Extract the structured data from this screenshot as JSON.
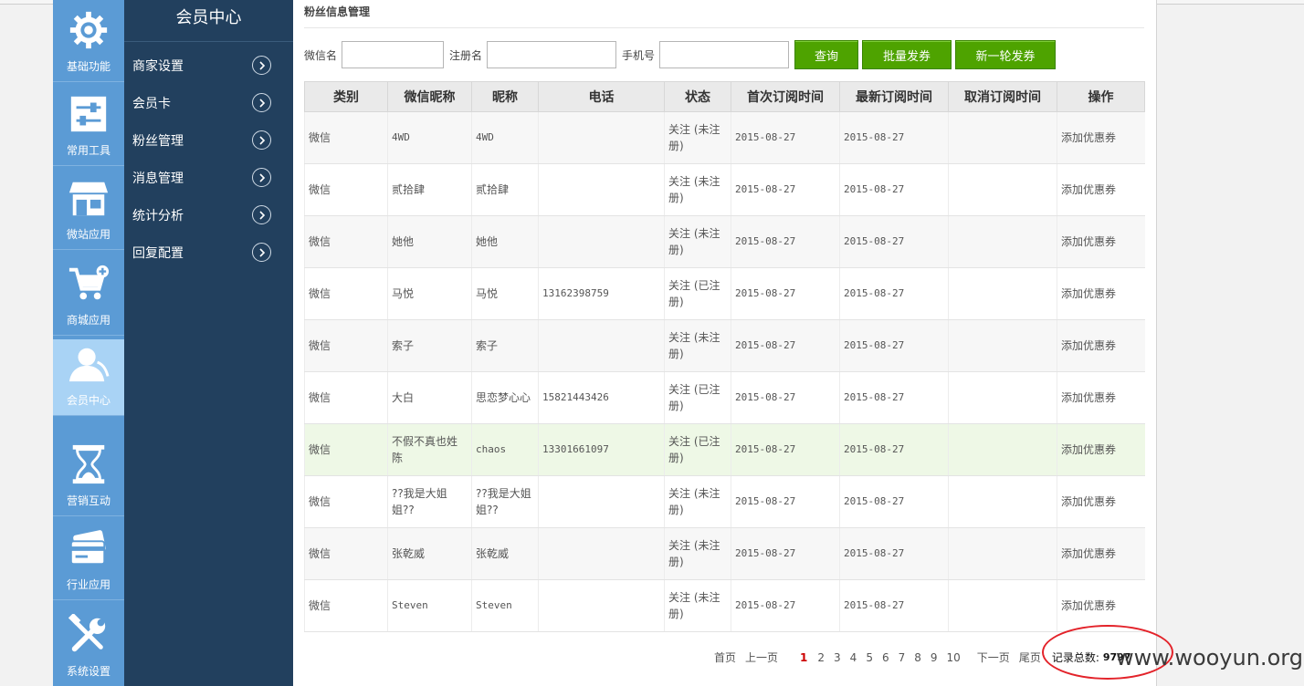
{
  "nav": [
    {
      "label": "基础功能",
      "icon": "gear-icon"
    },
    {
      "label": "常用工具",
      "icon": "toggle-tools-icon"
    },
    {
      "label": "微站应用",
      "icon": "storefront-icon"
    },
    {
      "label": "商城应用",
      "icon": "cart-add-icon"
    },
    {
      "label": "会员中心",
      "icon": "member-user-icon"
    },
    {
      "label": "营销互动",
      "icon": "hourglass-icon"
    },
    {
      "label": "行业应用",
      "icon": "cards-icon"
    },
    {
      "label": "系统设置",
      "icon": "tools-wrench-icon"
    }
  ],
  "submenu": {
    "title": "会员中心",
    "items": [
      "商家设置",
      "会员卡",
      "粉丝管理",
      "消息管理",
      "统计分析",
      "回复配置"
    ]
  },
  "page": {
    "title": "粉丝信息管理"
  },
  "search": {
    "wechat_label": "微信名",
    "reg_label": "注册名",
    "phone_label": "手机号",
    "query_btn": "查询",
    "batch_btn": "批量发券",
    "new_round_btn": "新一轮发券"
  },
  "table": {
    "headers": [
      "类别",
      "微信昵称",
      "昵称",
      "电话",
      "状态",
      "首次订阅时间",
      "最新订阅时间",
      "取消订阅时间",
      "操作"
    ],
    "rows": [
      [
        "微信",
        "4WD",
        "4WD",
        "",
        "关注 (未注册)",
        "2015-08-27",
        "2015-08-27",
        "",
        "添加优惠券"
      ],
      [
        "微信",
        "贰拾肆",
        "贰拾肆",
        "",
        "关注 (未注册)",
        "2015-08-27",
        "2015-08-27",
        "",
        "添加优惠券"
      ],
      [
        "微信",
        "她他",
        "她他",
        "",
        "关注 (未注册)",
        "2015-08-27",
        "2015-08-27",
        "",
        "添加优惠券"
      ],
      [
        "微信",
        "马悦",
        "马悦",
        "13162398759",
        "关注 (已注册)",
        "2015-08-27",
        "2015-08-27",
        "",
        "添加优惠券"
      ],
      [
        "微信",
        "索子",
        "索子",
        "",
        "关注 (未注册)",
        "2015-08-27",
        "2015-08-27",
        "",
        "添加优惠券"
      ],
      [
        "微信",
        "大白",
        "思恋梦心心",
        "15821443426",
        "关注 (已注册)",
        "2015-08-27",
        "2015-08-27",
        "",
        "添加优惠券"
      ],
      [
        "微信",
        "不假不真也姓陈",
        "chaos",
        "13301661097",
        "关注 (已注册)",
        "2015-08-27",
        "2015-08-27",
        "",
        "添加优惠券"
      ],
      [
        "微信",
        "??我是大姐姐??",
        "??我是大姐姐??",
        "",
        "关注 (未注册)",
        "2015-08-27",
        "2015-08-27",
        "",
        "添加优惠券"
      ],
      [
        "微信",
        "张乾威",
        "张乾威",
        "",
        "关注 (未注册)",
        "2015-08-27",
        "2015-08-27",
        "",
        "添加优惠券"
      ],
      [
        "微信",
        "Steven",
        "Steven",
        "",
        "关注 (未注册)",
        "2015-08-27",
        "2015-08-27",
        "",
        "添加优惠券"
      ]
    ],
    "highlighted_row": 6
  },
  "pager": {
    "first": "首页",
    "prev": "上一页",
    "current": "1",
    "pages": [
      "2",
      "3",
      "4",
      "5",
      "6",
      "7",
      "8",
      "9",
      "10"
    ],
    "next": "下一页",
    "last": "尾页",
    "total_label": "记录总数:",
    "total_value": "9797"
  },
  "watermark": "www.wooyun.org",
  "colors": {
    "accent": "#4ea300",
    "nav_bg": "#5b9bd5",
    "submenu_bg": "#22405e",
    "annotation": "#e3232a"
  }
}
